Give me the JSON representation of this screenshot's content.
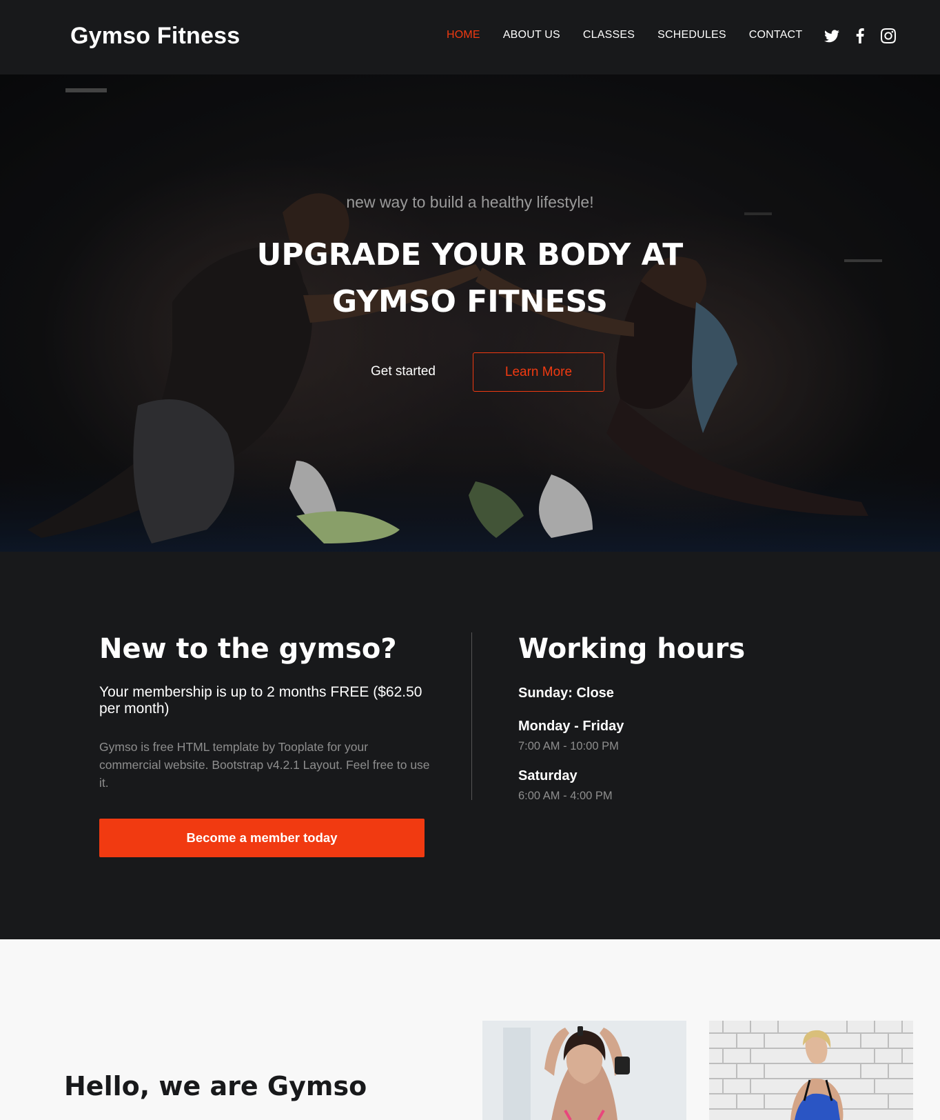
{
  "nav": {
    "brand": "Gymso Fitness",
    "links": [
      {
        "label": "HOME",
        "active": true
      },
      {
        "label": "ABOUT US",
        "active": false
      },
      {
        "label": "CLASSES",
        "active": false
      },
      {
        "label": "SCHEDULES",
        "active": false
      },
      {
        "label": "CONTACT",
        "active": false
      }
    ],
    "social": [
      "twitter-icon",
      "facebook-icon",
      "instagram-icon"
    ]
  },
  "hero": {
    "subtitle": "new way to build a healthy lifestyle!",
    "title_line1": "UPGRADE YOUR BODY AT",
    "title_line2": "GYMSO FITNESS",
    "get_started": "Get started",
    "learn_more": "Learn More"
  },
  "info": {
    "new_heading": "New to the gymso?",
    "membership": "Your membership is up to 2 months FREE ($62.50 per month)",
    "description": "Gymso is free HTML template by Tooplate for your commercial website. Bootstrap v4.2.1 Layout. Feel free to use it.",
    "member_button": "Become a member today",
    "hours_heading": "Working hours",
    "sunday": "Sunday: Close",
    "weekday_label": "Monday - Friday",
    "weekday_time": "7:00 AM - 10:00 PM",
    "saturday_label": "Saturday",
    "saturday_time": "6:00 AM - 4:00 PM"
  },
  "about": {
    "heading": "Hello, we are Gymso"
  },
  "colors": {
    "accent": "#f13a11",
    "dark_bg": "#18191b",
    "light_bg": "#f8f8f8"
  }
}
